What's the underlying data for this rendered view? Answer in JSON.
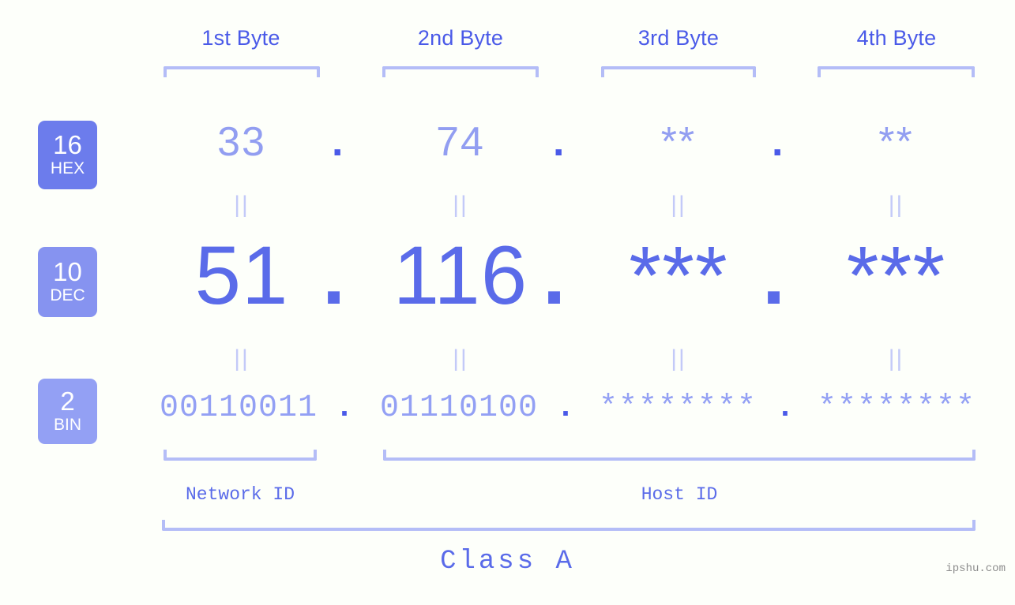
{
  "page": {
    "background_color": "#fdfffa",
    "accent_color": "#5a6be9",
    "light_accent_color": "#b4bdf7",
    "watermark": "ipshu.com"
  },
  "byte_headers": [
    {
      "label": "1st Byte"
    },
    {
      "label": "2nd Byte"
    },
    {
      "label": "3rd Byte"
    },
    {
      "label": "4th Byte"
    }
  ],
  "bases": [
    {
      "number": "16",
      "name": "HEX",
      "color": "#6c7cec"
    },
    {
      "number": "10",
      "name": "DEC",
      "color": "#8693f0"
    },
    {
      "number": "2",
      "name": "BIN",
      "color": "#93a0f4"
    }
  ],
  "rows": {
    "hex": {
      "values": [
        "33",
        "74",
        "**",
        "**"
      ],
      "separator": "."
    },
    "dec": {
      "values": [
        "51",
        "116",
        "***",
        "***"
      ],
      "separator": "."
    },
    "bin": {
      "values": [
        "00110011",
        "01110100",
        "********",
        "********"
      ],
      "separator": "."
    }
  },
  "equals_marks": {
    "symbol": "||"
  },
  "sections": [
    {
      "label": "Network ID"
    },
    {
      "label": "Host ID"
    }
  ],
  "class": {
    "label": "Class A"
  }
}
